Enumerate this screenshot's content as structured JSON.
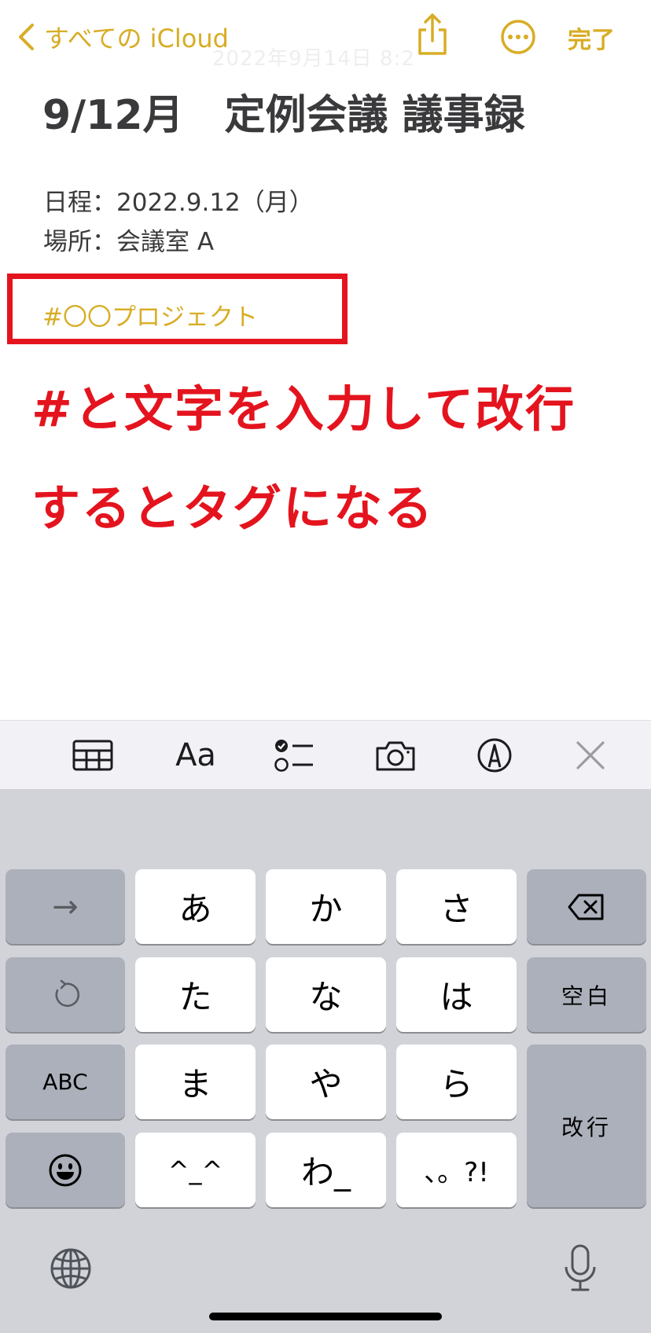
{
  "nav": {
    "back_label": "すべての iCloud",
    "done_label": "完了",
    "faint_date": "2022年9月14日 8:2"
  },
  "note": {
    "title": "9/12月　定例会議 議事録",
    "line_date": "日程：2022.9.12（月）",
    "line_place": "場所：会議室 A",
    "tag": "#〇〇プロジェクト"
  },
  "annotation": {
    "line1": "#と文字を入力して改行",
    "line2": "するとタグになる"
  },
  "toolbar": {
    "format_label": "Aa",
    "icons": [
      "table-icon",
      "format-icon",
      "checklist-icon",
      "camera-icon",
      "markup-icon",
      "close-icon"
    ]
  },
  "keyboard": {
    "arrow": "→",
    "keys": {
      "a": "あ",
      "ka": "か",
      "sa": "さ",
      "ta": "た",
      "na": "な",
      "ha": "は",
      "ma": "ま",
      "ya": "や",
      "ra": "ら",
      "kao": "^_^",
      "wa": "わ_",
      "punct": "、。?!"
    },
    "space": "空白",
    "abc": "ABC",
    "return": "改行"
  },
  "colors": {
    "accent": "#D8AD25",
    "annotation_red": "#E4141E",
    "keyboard_bg": "#D1D3D9",
    "dark_key": "#ABB0BA"
  }
}
